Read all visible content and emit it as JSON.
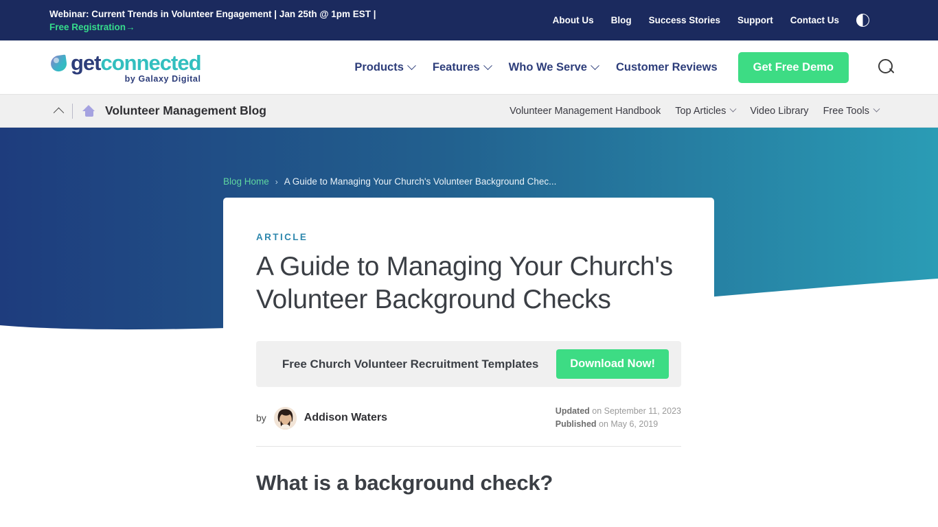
{
  "topbar": {
    "promo_text": "Webinar: Current Trends in Volunteer Engagement | Jan 25th @ 1pm EST |",
    "promo_link": "Free Registration→",
    "links": [
      "About Us",
      "Blog",
      "Success Stories",
      "Support",
      "Contact Us"
    ],
    "contrast_toggle": "contrast-toggle-icon",
    "bg_color": "#1b2a5e",
    "link_accent": "#36dc8c"
  },
  "header": {
    "logo": {
      "primary": "get",
      "secondary": "connected",
      "tagline": "by Galaxy Digital"
    },
    "nav": [
      {
        "label": "Products",
        "has_dropdown": true
      },
      {
        "label": "Features",
        "has_dropdown": true
      },
      {
        "label": "Who We Serve",
        "has_dropdown": true
      },
      {
        "label": "Customer Reviews",
        "has_dropdown": false
      }
    ],
    "cta_label": "Get Free Demo",
    "cta_color": "#3ddc84",
    "search_icon": "search-icon"
  },
  "subnav": {
    "collapse_icon": "chevron-up-icon",
    "home_icon": "home-icon",
    "title": "Volunteer Management Blog",
    "links": [
      {
        "label": "Volunteer Management Handbook",
        "has_dropdown": false
      },
      {
        "label": "Top Articles",
        "has_dropdown": true
      },
      {
        "label": "Video Library",
        "has_dropdown": false
      },
      {
        "label": "Free Tools",
        "has_dropdown": true
      }
    ]
  },
  "hero": {
    "gradient_start": "#1e3c7d",
    "gradient_end": "#2a9cb5"
  },
  "breadcrumb": {
    "home": "Blog Home",
    "separator": "›",
    "current": "A Guide to Managing Your Church's Volunteer Background Chec..."
  },
  "article": {
    "eyebrow": "ARTICLE",
    "eyebrow_color": "#2d87ad",
    "title": "A Guide to Managing Your Church's Volunteer Background Checks",
    "cta": {
      "text": "Free Church Volunteer Recruitment Templates",
      "button_label": "Download Now!"
    },
    "byline": {
      "by_label": "by",
      "author": "Addison Waters",
      "avatar": "author-avatar"
    },
    "dates": {
      "updated_label": "Updated",
      "updated_value": " on September 11, 2023",
      "published_label": "Published",
      "published_value": " on May 6, 2019"
    },
    "section_heading": "What is a background check?"
  }
}
